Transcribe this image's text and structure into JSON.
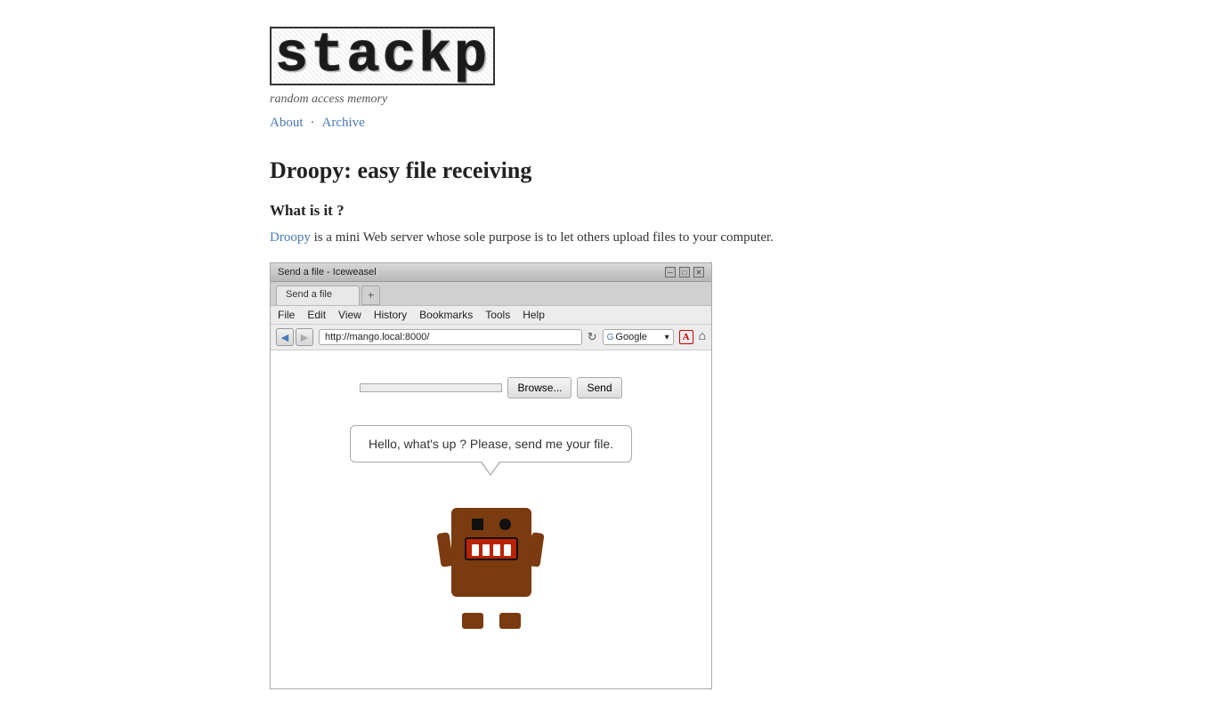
{
  "site": {
    "title": "stackp",
    "tagline": "random access memory",
    "nav": {
      "about_label": "About",
      "archive_label": "Archive"
    }
  },
  "post": {
    "title": "Droopy: easy file receiving",
    "what_is_it_heading": "What is it ?",
    "description_prefix": " is a mini Web server whose sole purpose is to let others upload files to your computer.",
    "droopy_link_text": "Droopy"
  },
  "browser_screenshot": {
    "title": "Send a file - Iceweasel",
    "window_controls": [
      "─",
      "□",
      "✕"
    ],
    "menu_items": [
      "File",
      "Edit",
      "View",
      "History",
      "Bookmarks",
      "Tools",
      "Help"
    ],
    "tab_label": "Send a file",
    "address_bar_value": "http://mango.local:8000/",
    "search_placeholder": "Google",
    "browse_btn_label": "Browse...",
    "send_btn_label": "Send",
    "speech_bubble_text": "Hello, what's up ? Please, send me your file."
  }
}
